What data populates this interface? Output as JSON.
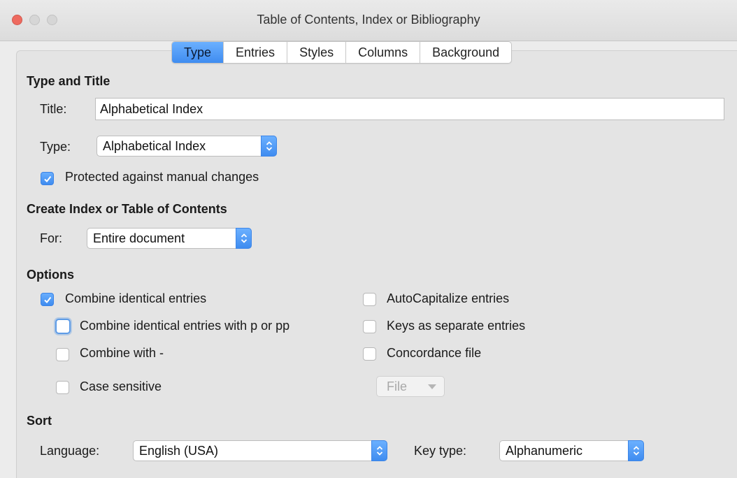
{
  "window": {
    "title": "Table of Contents, Index or Bibliography"
  },
  "tabs": [
    "Type",
    "Entries",
    "Styles",
    "Columns",
    "Background"
  ],
  "type_and_title": {
    "heading": "Type and Title",
    "title_label": "Title:",
    "title_value": "Alphabetical Index",
    "type_label": "Type:",
    "type_value": "Alphabetical Index",
    "protected_label": "Protected against manual changes",
    "protected_checked": true
  },
  "create": {
    "heading": "Create Index or Table of Contents",
    "for_label": "For:",
    "for_value": "Entire document"
  },
  "options": {
    "heading": "Options",
    "combine_identical": {
      "label": "Combine identical entries",
      "checked": true
    },
    "combine_p_pp": {
      "label": "Combine identical entries with p or pp",
      "checked": false
    },
    "combine_with_dash": {
      "label": "Combine with -",
      "checked": false
    },
    "case_sensitive": {
      "label": "Case sensitive",
      "checked": false
    },
    "autocapitalize": {
      "label": "AutoCapitalize entries",
      "checked": false
    },
    "keys_separate": {
      "label": "Keys as separate entries",
      "checked": false
    },
    "concordance": {
      "label": "Concordance file",
      "checked": false
    },
    "file_button": "File"
  },
  "sort": {
    "heading": "Sort",
    "language_label": "Language:",
    "language_value": "English (USA)",
    "keytype_label": "Key type:",
    "keytype_value": "Alphanumeric"
  },
  "colors": {
    "accent": "#3f8cf0",
    "panel": "#e4e4e4",
    "close": "#ee6a5f"
  }
}
